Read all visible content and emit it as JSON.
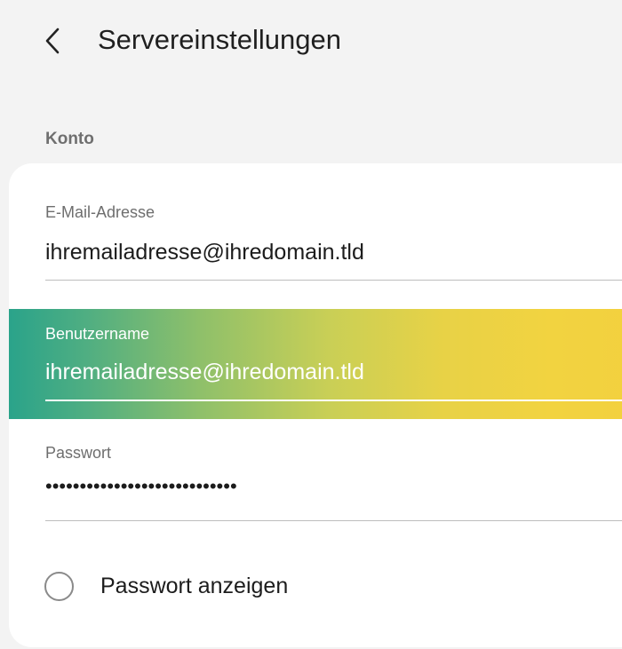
{
  "header": {
    "title": "Servereinstellungen",
    "back_icon": "chevron-left-icon"
  },
  "section": {
    "label": "Konto"
  },
  "fields": {
    "email": {
      "label": "E-Mail-Adresse",
      "value": "ihremailadresse@ihredomain.tld"
    },
    "username": {
      "label": "Benutzername",
      "value": "ihremailadresse@ihredomain.tld"
    },
    "password": {
      "label": "Passwort",
      "value": "••••••••••••••••••••••••••••"
    }
  },
  "show_password": {
    "label": "Passwort anzeigen",
    "checked": false
  },
  "colors": {
    "background": "#f3f3f3",
    "card": "#ffffff",
    "gradient_start": "#2aa38a",
    "gradient_end": "#f3d03e"
  }
}
